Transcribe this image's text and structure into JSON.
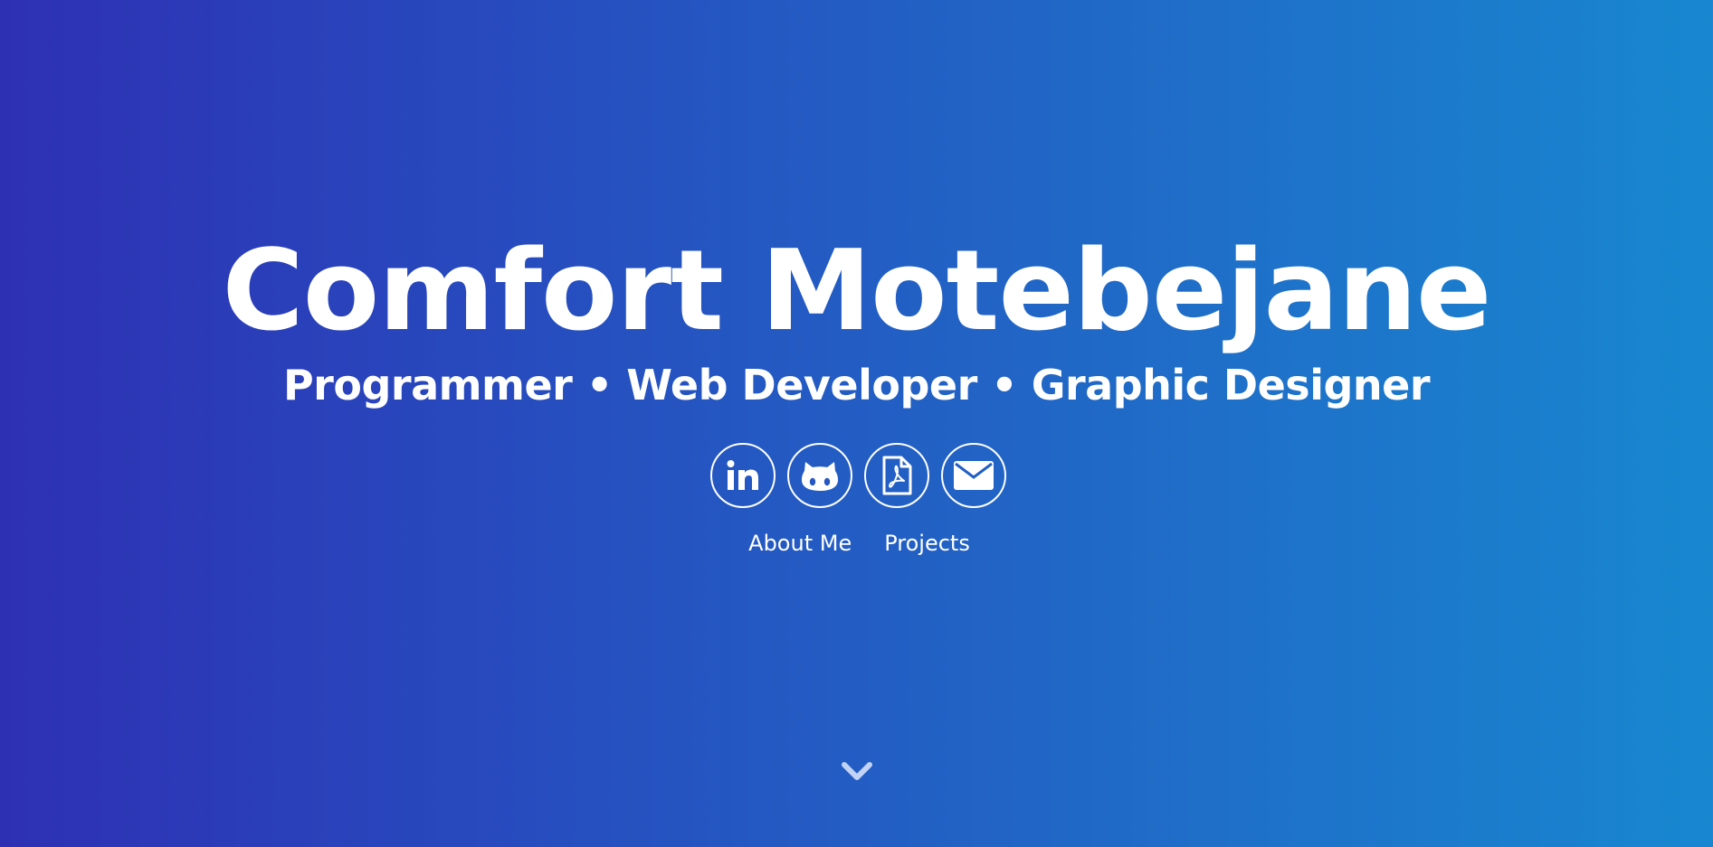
{
  "hero": {
    "name": "Comfort Motebejane",
    "tagline": "Programmer • Web Developer • Graphic Designer"
  },
  "social": [
    {
      "icon": "linkedin-icon"
    },
    {
      "icon": "github-icon"
    },
    {
      "icon": "pdf-resume-icon"
    },
    {
      "icon": "envelope-icon"
    }
  ],
  "nav": {
    "about_label": "About Me",
    "projects_label": "Projects"
  },
  "scroll": {
    "icon": "chevron-down-icon"
  },
  "colors": {
    "gradient_start": "#2e30b4",
    "gradient_end": "#1887d0",
    "text": "#ffffff"
  }
}
